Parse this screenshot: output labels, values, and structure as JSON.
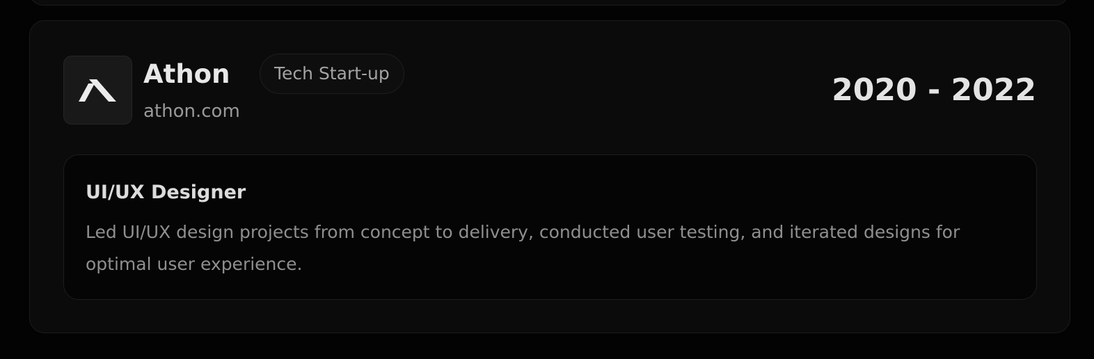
{
  "experience": {
    "company": {
      "name": "Athon",
      "url": "athon.com",
      "logo_icon": "athon-logo-icon",
      "tag": "Tech Start-up"
    },
    "period": "2020 - 2022",
    "role": {
      "title": "UI/UX Designer",
      "description": "Led UI/UX design projects from concept to delivery, conducted user testing, and iterated designs for optimal user experience."
    }
  },
  "colors": {
    "background": "#030303",
    "card": "#0b0b0b",
    "text_primary": "#e6e6e6",
    "text_secondary": "#9a9a9a"
  }
}
